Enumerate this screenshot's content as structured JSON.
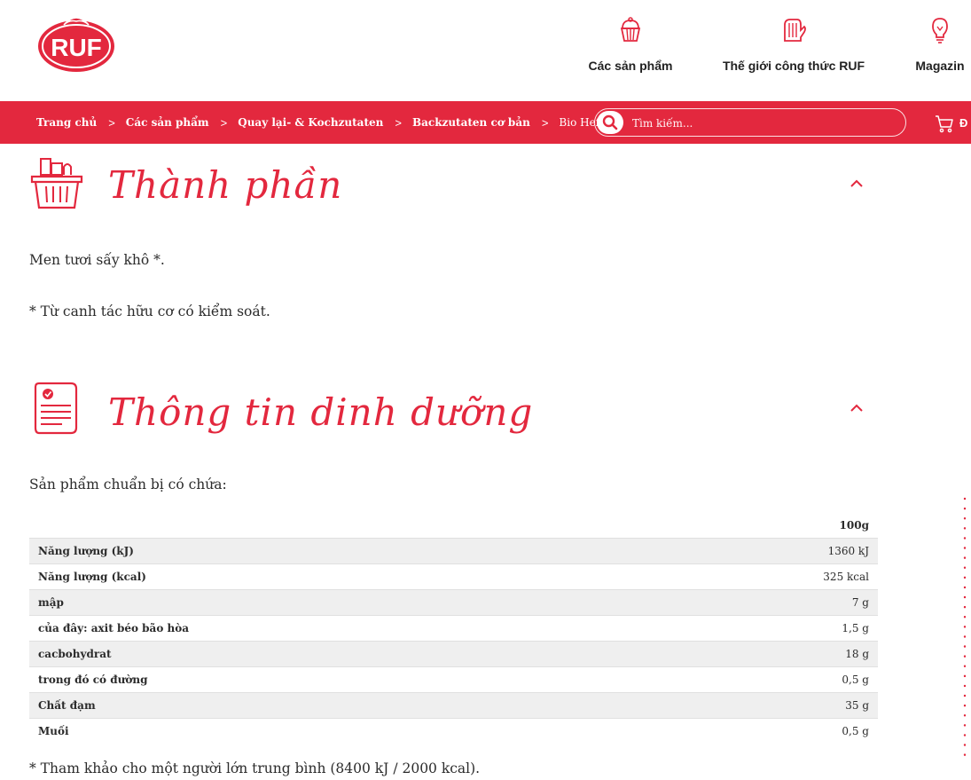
{
  "brand": {
    "logo_text": "RUF",
    "color": "#e3283e"
  },
  "nav": {
    "products_label": "Các sản phẩm",
    "recipes_label": "Thế giới công thức RUF",
    "magazin_label": "Magazin"
  },
  "breadcrumb": {
    "items": [
      "Trang chủ",
      "Các sản phẩm",
      "Quay lại- & Kochzutaten",
      "Backzutaten cơ bản",
      "Bio Hefe"
    ],
    "separator": ">"
  },
  "search": {
    "placeholder": "Tìm kiếm..."
  },
  "cart": {
    "label": "Đ"
  },
  "ingredients": {
    "title": "Thành phần",
    "line1": "Men tươi sấy khô *.",
    "line2": "* Từ canh tác hữu cơ có kiểm soát."
  },
  "nutrition": {
    "title": "Thông tin dinh dưỡng",
    "intro": "Sản phẩm chuẩn bị có chứa:",
    "column_header": "100g",
    "rows": [
      {
        "label": "Năng lượng (kJ)",
        "value": "1360 kJ"
      },
      {
        "label": "Năng lượng (kcal)",
        "value": "325 kcal"
      },
      {
        "label": "mập",
        "value": "7 g"
      },
      {
        "label": "của đây: axit béo bão hòa",
        "value": "1,5 g"
      },
      {
        "label": "cacbohydrat",
        "value": "18 g"
      },
      {
        "label": "trong đó có đường",
        "value": "0,5 g"
      },
      {
        "label": "Chất đạm",
        "value": "35 g"
      },
      {
        "label": "Muối",
        "value": "0,5 g"
      }
    ],
    "footnote": "* Tham khảo cho một người lớn trung bình (8400 kJ / 2000 kcal)."
  }
}
